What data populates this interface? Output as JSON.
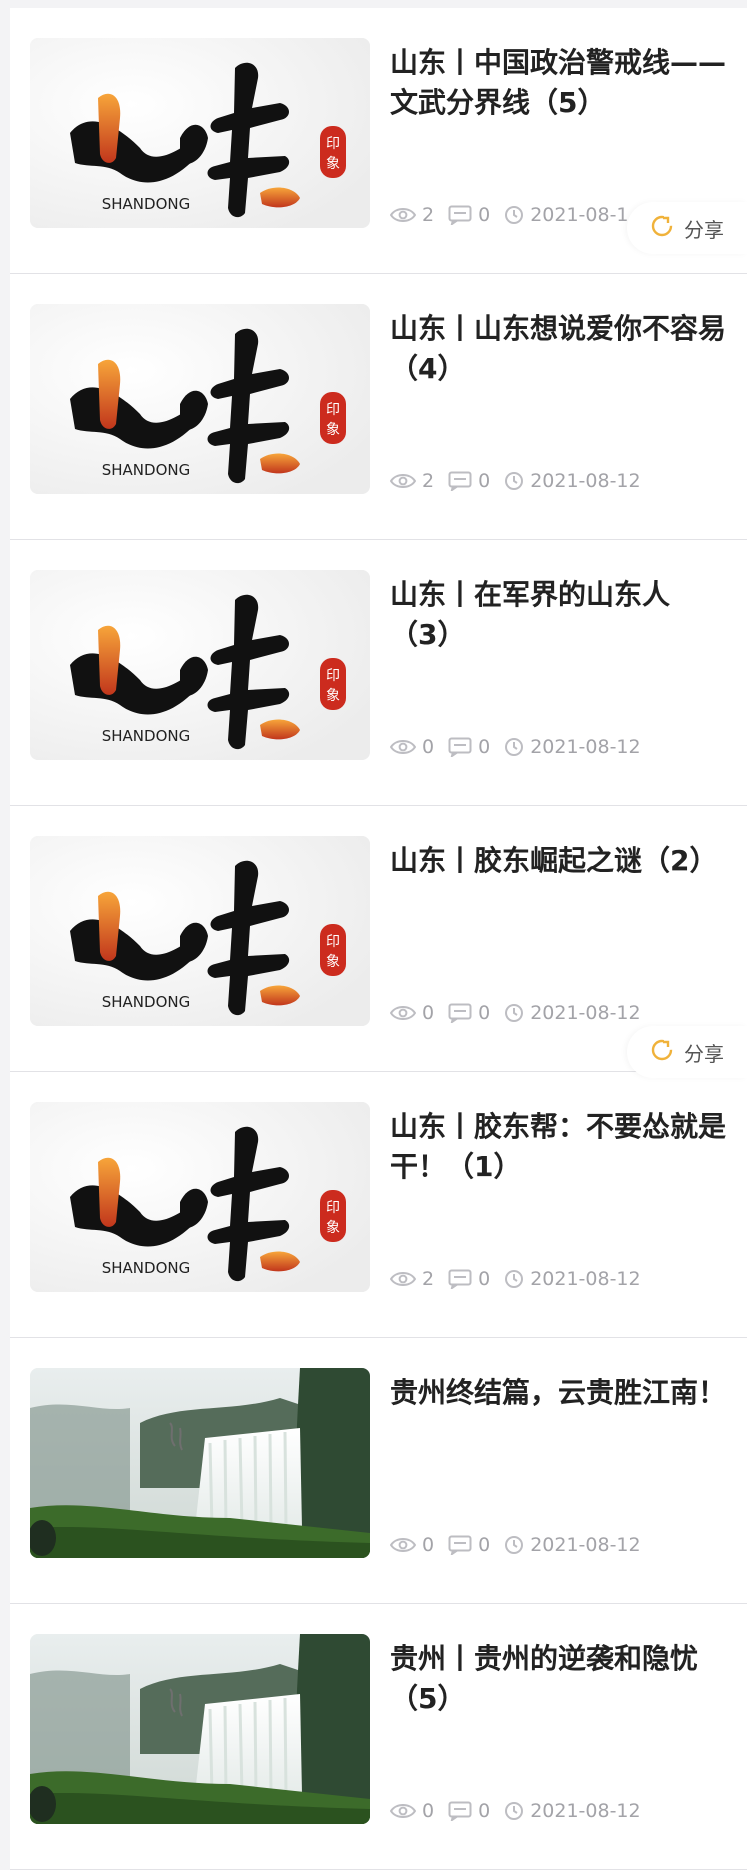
{
  "colors": {
    "background": "#f3f3f5",
    "card": "#ffffff",
    "title": "#222222",
    "meta": "#a3a3a8",
    "share_icon": "#f0b23a"
  },
  "thumbs": {
    "shandong_label": "SHANDONG",
    "seal_text": "印象"
  },
  "share": {
    "label": "分享",
    "icon": "share-icon"
  },
  "articles": [
    {
      "title": "山东丨中国政治警戒线——文武分界线（5）",
      "views": "2",
      "comments": "0",
      "date": "2021-08-1",
      "image": "shandong"
    },
    {
      "title": "山东丨山东想说爱你不容易（4）",
      "views": "2",
      "comments": "0",
      "date": "2021-08-12",
      "image": "shandong"
    },
    {
      "title": "山东丨在军界的山东人（3）",
      "views": "0",
      "comments": "0",
      "date": "2021-08-12",
      "image": "shandong"
    },
    {
      "title": "山东丨胶东崛起之谜（2）",
      "views": "0",
      "comments": "0",
      "date": "2021-08-12",
      "image": "shandong"
    },
    {
      "title": "山东丨胶东帮：不要怂就是干！（1）",
      "views": "2",
      "comments": "0",
      "date": "2021-08-12",
      "image": "shandong"
    },
    {
      "title": "贵州终结篇，云贵胜江南！",
      "views": "0",
      "comments": "0",
      "date": "2021-08-12",
      "image": "guizhou"
    },
    {
      "title": "贵州丨贵州的逆袭和隐忧（5）",
      "views": "0",
      "comments": "0",
      "date": "2021-08-12",
      "image": "guizhou"
    }
  ]
}
